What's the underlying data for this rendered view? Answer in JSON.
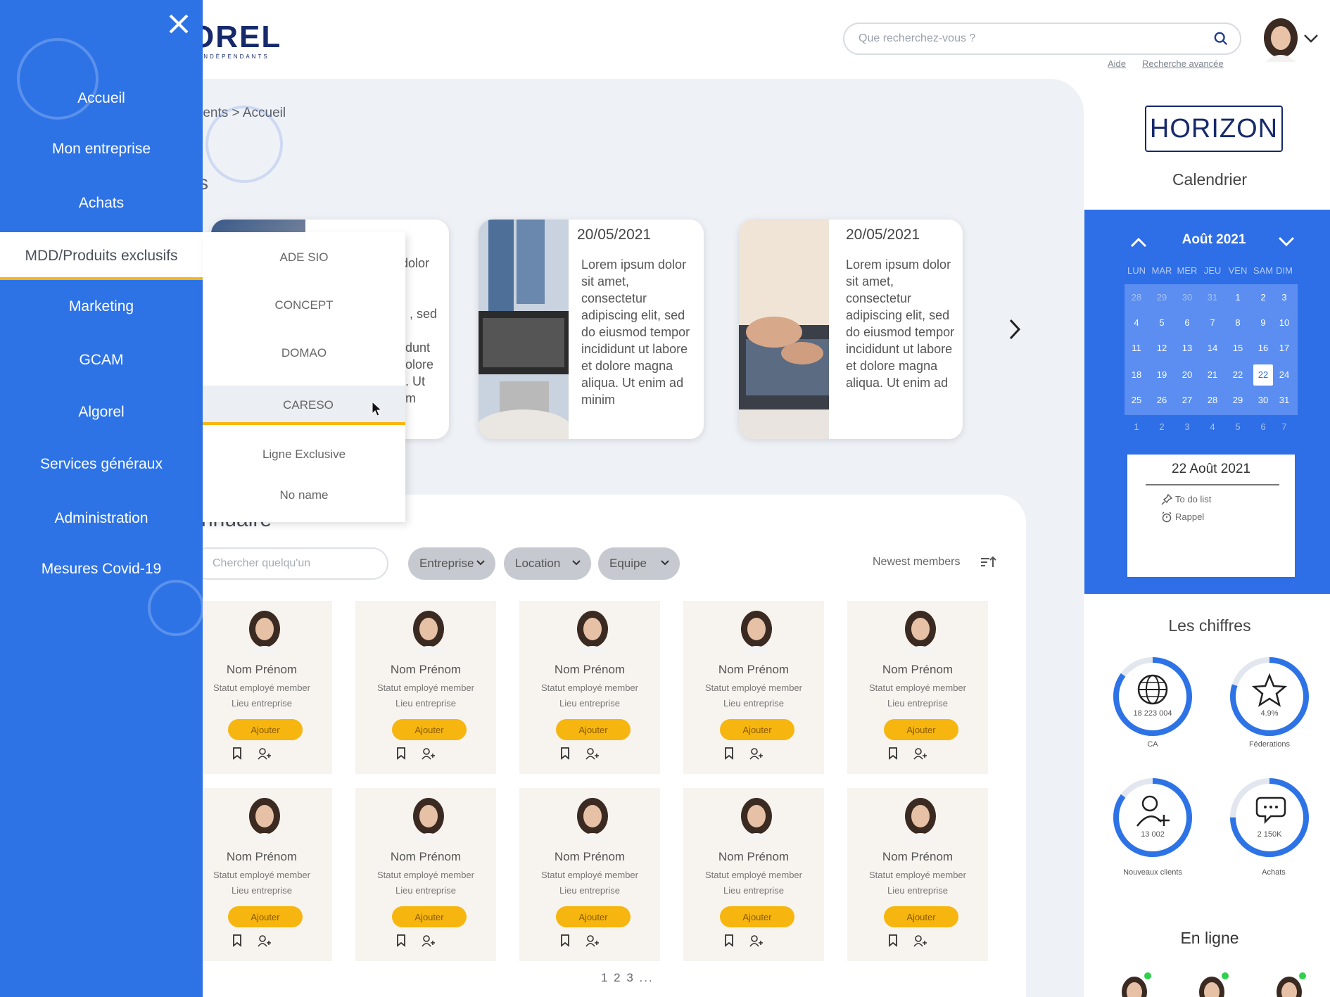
{
  "header": {
    "logo_text": "OREL",
    "logo_sub": "INDÉPENDANTS",
    "search_placeholder": "Que recherchez-vous ?",
    "links": [
      "Aide",
      "Recherche avancée"
    ]
  },
  "sidebar": {
    "items": [
      "Accueil",
      "Mon entreprise",
      "Achats",
      "MDD/Produits exclusifs",
      "Marketing",
      "GCAM",
      "Algorel",
      "Services généraux",
      "Administration",
      "Mesures Covid-19"
    ],
    "active_index": 3
  },
  "submenu": {
    "items": [
      "ADE SIO",
      "CONCEPT",
      "DOMAO",
      "CARESO",
      "Ligne Exclusive",
      "No name"
    ],
    "active_index": 3
  },
  "main": {
    "breadcrumb": "rents > Accueil",
    "section_title": "s",
    "news": [
      {
        "date": "20/05/2021",
        "text": "Lorem ipsum dolor sit amet, consectetur adipiscing elit, sed do eiusmod tempor incididunt ut labore et dolore magna aliqua. Ut enim ad minim"
      },
      {
        "date": "20/05/2021",
        "text": "Lorem ipsum dolor sit amet, consectetur adipiscing elit, sed do eiusmod tempor incididunt ut labore et dolore magna aliqua. Ut enim ad"
      }
    ],
    "hidden_card_fragments": [
      "dolor",
      ", sed",
      "dunt",
      "olore",
      ". Ut",
      "m"
    ]
  },
  "annuaire": {
    "title": "nnuaire",
    "search_placeholder": "Chercher quelqu'un",
    "filters": [
      "Entreprise",
      "Location",
      "Equipe"
    ],
    "sort_label": "Newest members",
    "people": [
      {
        "name": "Nom Prénom",
        "status": "Statut employé member",
        "location": "Lieu entreprise",
        "button": "Ajouter"
      },
      {
        "name": "Nom Prénom",
        "status": "Statut employé member",
        "location": "Lieu entreprise",
        "button": "Ajouter"
      },
      {
        "name": "Nom Prénom",
        "status": "Statut employé member",
        "location": "Lieu entreprise",
        "button": "Ajouter"
      },
      {
        "name": "Nom Prénom",
        "status": "Statut employé member",
        "location": "Lieu entreprise",
        "button": "Ajouter"
      },
      {
        "name": "Nom Prénom",
        "status": "Statut employé member",
        "location": "Lieu entreprise",
        "button": "Ajouter"
      },
      {
        "name": "Nom Prénom",
        "status": "Statut employé member",
        "location": "Lieu entreprise",
        "button": "Ajouter"
      },
      {
        "name": "Nom Prénom",
        "status": "Statut employé member",
        "location": "Lieu entreprise",
        "button": "Ajouter"
      },
      {
        "name": "Nom Prénom",
        "status": "Statut employé member",
        "location": "Lieu entreprise",
        "button": "Ajouter"
      },
      {
        "name": "Nom Prénom",
        "status": "Statut employé member",
        "location": "Lieu entreprise",
        "button": "Ajouter"
      },
      {
        "name": "Nom Prénom",
        "status": "Statut employé member",
        "location": "Lieu entreprise",
        "button": "Ajouter"
      }
    ],
    "pagination": "1 2 3 ..."
  },
  "right": {
    "brand": "HORIZON",
    "calendar_title": "Calendrier",
    "month": "Août 2021",
    "weekdays": [
      "LUN",
      "MAR",
      "MER",
      "JEU",
      "VEN",
      "SAM",
      "DIM"
    ],
    "weeks": [
      [
        "28",
        "29",
        "30",
        "31",
        "1",
        "2",
        "3"
      ],
      [
        "4",
        "5",
        "6",
        "7",
        "8",
        "9",
        "10"
      ],
      [
        "11",
        "12",
        "13",
        "14",
        "15",
        "16",
        "17"
      ],
      [
        "18",
        "19",
        "20",
        "21",
        "22",
        "22",
        "24"
      ],
      [
        "25",
        "26",
        "27",
        "28",
        "29",
        "30",
        "31"
      ],
      [
        "1",
        "2",
        "3",
        "4",
        "5",
        "6",
        "7"
      ]
    ],
    "selected_date": "22 Août 2021",
    "agenda_items": [
      "To do list",
      "Rappel"
    ],
    "stats_title": "Les chiffres",
    "stats": [
      {
        "value": "18 223 004",
        "label": "CA",
        "icon": "globe-icon",
        "progress": 0.85
      },
      {
        "value": "4.9%",
        "label": "Féderations",
        "icon": "star-icon",
        "progress": 0.8
      },
      {
        "value": "13 002",
        "label": "Nouveaux clients",
        "icon": "user-plus-icon",
        "progress": 0.85
      },
      {
        "value": "2 150K",
        "label": "Achats",
        "icon": "chat-icon",
        "progress": 0.75
      }
    ],
    "online_title": "En ligne"
  },
  "colors": {
    "sidebar_blue": "#2d73e6",
    "accent_yellow": "#f6b60f",
    "navy": "#16296b",
    "online_green": "#2ed14b"
  }
}
